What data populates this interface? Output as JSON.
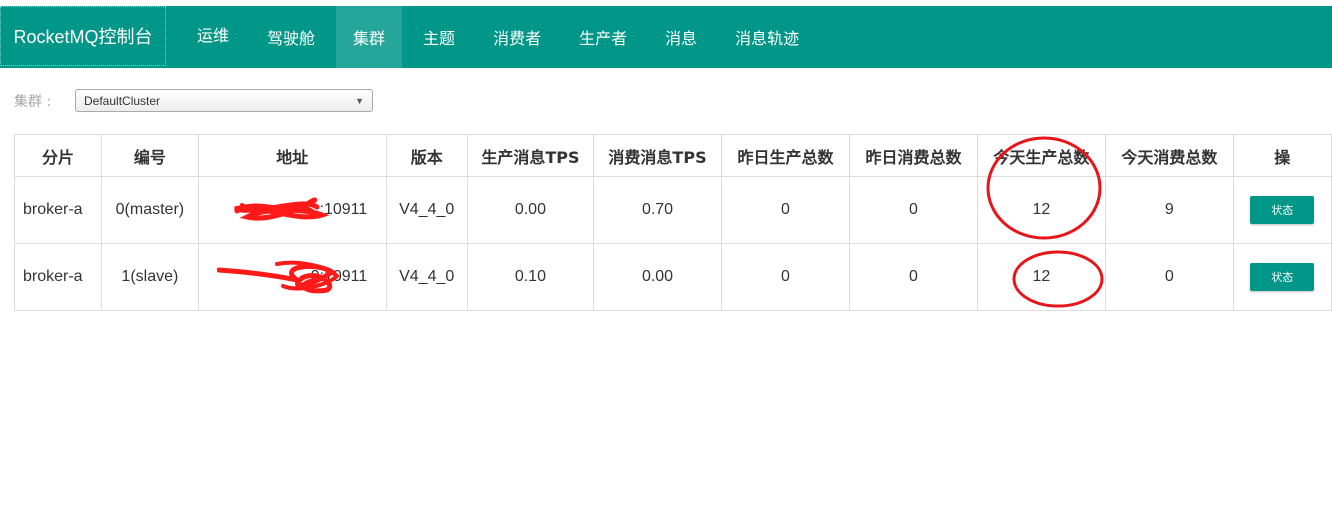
{
  "app": {
    "brand": "RocketMQ控制台"
  },
  "nav": {
    "items": [
      {
        "label": "运维"
      },
      {
        "label": "驾驶舱"
      },
      {
        "label": "集群",
        "active": true
      },
      {
        "label": "主题"
      },
      {
        "label": "消费者"
      },
      {
        "label": "生产者"
      },
      {
        "label": "消息"
      },
      {
        "label": "消息轨迹"
      }
    ]
  },
  "filter": {
    "label": "集群 :",
    "selected": "DefaultCluster"
  },
  "table": {
    "headers": [
      "分片",
      "编号",
      "地址",
      "版本",
      "生产消息TPS",
      "消费消息TPS",
      "昨日生产总数",
      "昨日消费总数",
      "今天生产总数",
      "今天消费总数",
      "操"
    ],
    "rows": [
      {
        "shard": "broker-a",
        "id": "0(master)",
        "address": ":10911",
        "version": "V4_4_0",
        "produce_tps": "0.00",
        "consume_tps": "0.70",
        "yesterday_produce": "0",
        "yesterday_consume": "0",
        "today_produce": "12",
        "today_consume": "9",
        "action": "状态"
      },
      {
        "shard": "broker-a",
        "id": "1(slave)",
        "address": "0:10911",
        "version": "V4_4_0",
        "produce_tps": "0.10",
        "consume_tps": "0.00",
        "yesterday_produce": "0",
        "yesterday_consume": "0",
        "today_produce": "12",
        "today_consume": "0",
        "action": "状态"
      }
    ]
  },
  "colors": {
    "navbar": "#009688",
    "active_tab": "#26a69a",
    "button": "#009688",
    "annotation": "#e8141a"
  }
}
